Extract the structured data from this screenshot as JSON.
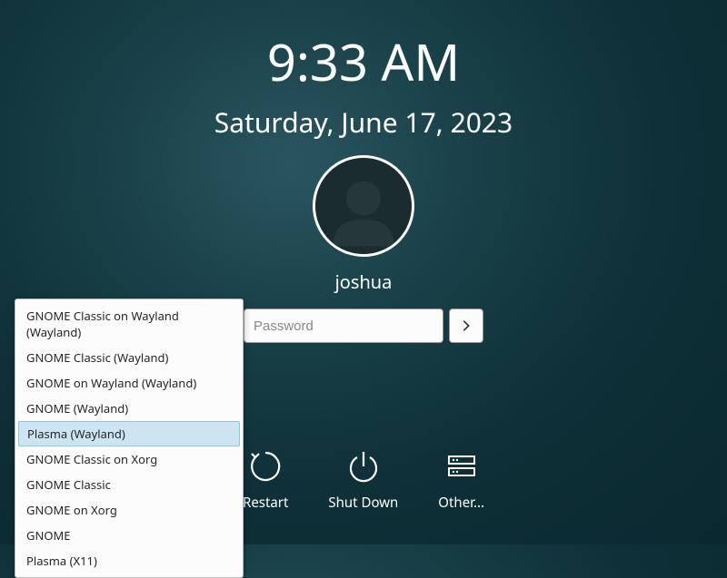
{
  "clock": {
    "time": "9:33 AM",
    "date": "Saturday, June 17, 2023"
  },
  "user": {
    "name": "joshua"
  },
  "password": {
    "placeholder": "Password"
  },
  "power": {
    "restart": "Restart",
    "shutdown": "Shut Down",
    "other": "Other..."
  },
  "sessions": {
    "items": [
      {
        "label": "GNOME Classic on Wayland (Wayland)",
        "selected": false
      },
      {
        "label": "GNOME Classic (Wayland)",
        "selected": false
      },
      {
        "label": "GNOME on Wayland (Wayland)",
        "selected": false
      },
      {
        "label": "GNOME (Wayland)",
        "selected": false
      },
      {
        "label": "Plasma (Wayland)",
        "selected": true
      },
      {
        "label": "GNOME Classic on Xorg",
        "selected": false
      },
      {
        "label": "GNOME Classic",
        "selected": false
      },
      {
        "label": "GNOME on Xorg",
        "selected": false
      },
      {
        "label": "GNOME",
        "selected": false
      },
      {
        "label": "Plasma (X11)",
        "selected": false
      }
    ]
  }
}
